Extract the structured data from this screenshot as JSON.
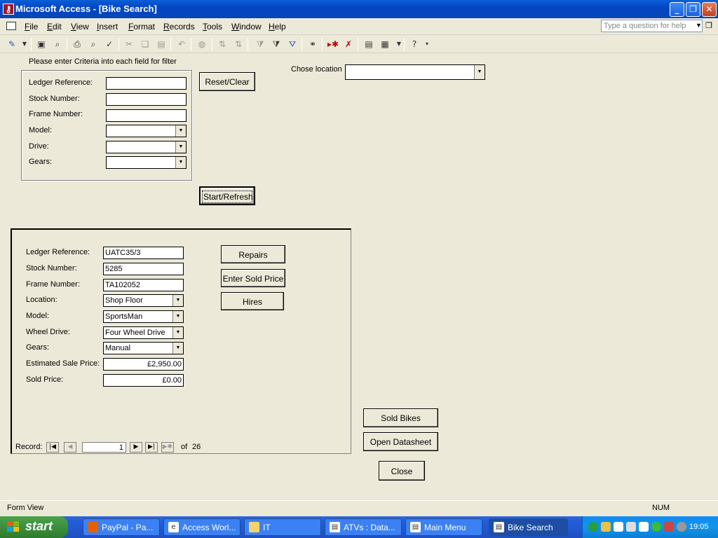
{
  "window": {
    "title": "Microsoft Access - [Bike Search]"
  },
  "menu": [
    "File",
    "Edit",
    "View",
    "Insert",
    "Format",
    "Records",
    "Tools",
    "Window",
    "Help"
  ],
  "help_placeholder": "Type a question for help",
  "filter": {
    "instruction": "Please enter Criteria into each field for filter",
    "ledger_label": "Ledger Reference:",
    "stock_label": "Stock Number:",
    "frame_label": "Frame Number:",
    "model_label": "Model:",
    "drive_label": "Drive:",
    "gears_label": "Gears:",
    "ledger_value": "",
    "stock_value": "",
    "frame_value": "",
    "model_value": "",
    "drive_value": "",
    "gears_value": "",
    "reset_label": "Reset/Clear",
    "start_label": "Start/Refresh",
    "location_label": "Chose location",
    "location_value": ""
  },
  "record": {
    "ledger_label": "Ledger Reference:",
    "ledger_value": "UATC35/3",
    "stock_label": "Stock Number:",
    "stock_value": "5285",
    "frame_label": "Frame Number:",
    "frame_value": "TA102052",
    "location_label": "Location:",
    "location_value": "Shop Floor",
    "model_label": "Model:",
    "model_value": "SportsMan",
    "drive_label": "Wheel Drive:",
    "drive_value": "Four Wheel Drive",
    "gears_label": "Gears:",
    "gears_value": "Manual",
    "est_label": "Estimated Sale Price:",
    "est_value": "£2,950.00",
    "sold_label": "Sold Price:",
    "sold_value": "£0.00",
    "repairs_label": "Repairs",
    "enter_sold_label": "Enter Sold Price",
    "hires_label": "Hires"
  },
  "nav": {
    "record_label": "Record:",
    "current": "1",
    "of_label": "of",
    "total": "26"
  },
  "buttons": {
    "sold_bikes": "Sold Bikes",
    "open_datasheet": "Open Datasheet",
    "close": "Close"
  },
  "status": {
    "mode": "Form View",
    "num": "NUM"
  },
  "taskbar": {
    "start": "start",
    "tasks": [
      "PayPal - Pa...",
      "Access Worl...",
      "IT",
      "ATVs : Data...",
      "Main Menu",
      "Bike Search"
    ],
    "clock": "19:05"
  }
}
